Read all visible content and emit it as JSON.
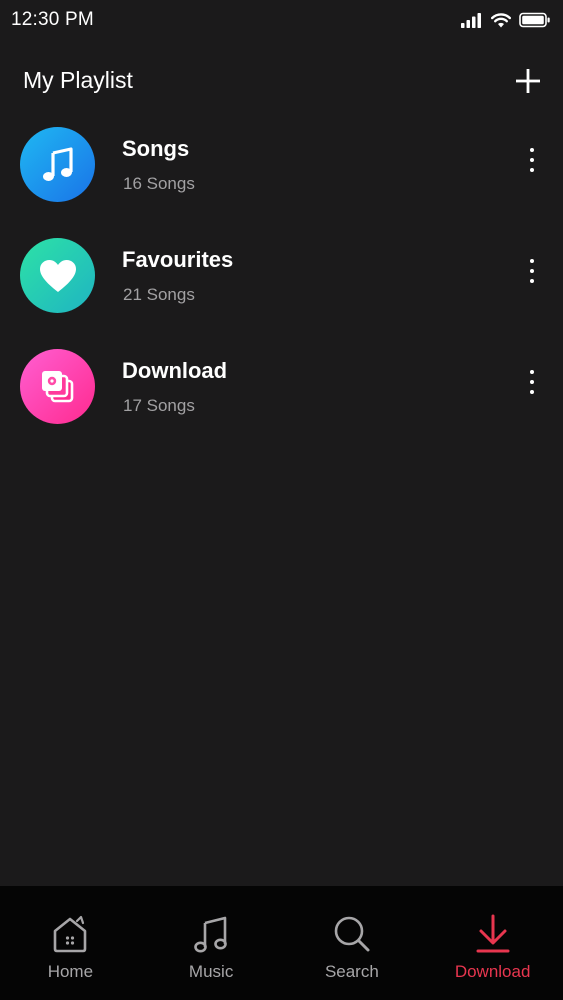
{
  "status_bar": {
    "time": "12:30 PM",
    "icons": [
      "signal-icon",
      "wifi-icon",
      "battery-icon"
    ]
  },
  "header": {
    "title": "My Playlist",
    "add_icon": "plus-icon"
  },
  "playlists": [
    {
      "title": "Songs",
      "count": "16 Songs",
      "icon": "music-note-icon",
      "gradient": [
        "#1fb8f2",
        "#1a73e8"
      ]
    },
    {
      "title": "Favourites",
      "count": "21 Songs",
      "icon": "heart-icon",
      "gradient": [
        "#2de2a6",
        "#1fb4c2"
      ]
    },
    {
      "title": "Download",
      "count": "17 Songs",
      "icon": "photo-stack-icon",
      "gradient": [
        "#ff5fd2",
        "#ff2a8f"
      ]
    }
  ],
  "bottom_nav": {
    "active": "Download",
    "items": [
      {
        "label": "Home",
        "icon": "home-icon"
      },
      {
        "label": "Music",
        "icon": "music-icon"
      },
      {
        "label": "Search",
        "icon": "search-icon"
      },
      {
        "label": "Download",
        "icon": "download-icon"
      }
    ]
  },
  "colors": {
    "background": "#1b1a1b",
    "nav_background": "#050505",
    "accent": "#e8364f",
    "secondary_text": "#a2a1a3"
  }
}
